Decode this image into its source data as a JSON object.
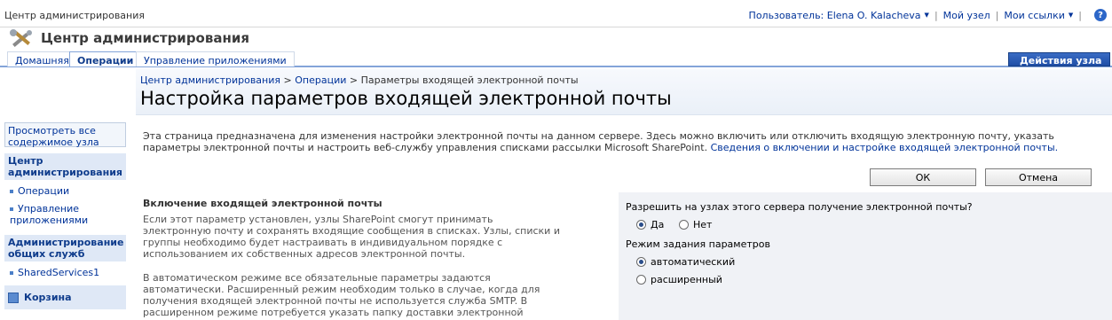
{
  "global": {
    "site_name": "Центр администрирования",
    "user_label": "Пользователь: Elena O. Kalacheva",
    "my_site": "Мой узел",
    "my_links": "Мои ссылки",
    "help": "?"
  },
  "title": {
    "site_title": "Центр администрирования"
  },
  "tabs": [
    {
      "label": "Домашняя",
      "selected": false
    },
    {
      "label": "Операции",
      "selected": true
    },
    {
      "label": "Управление приложениями",
      "selected": false
    }
  ],
  "site_actions": "Действия узла",
  "leftnav": {
    "view_all": "Просмотреть все содержимое узла",
    "heading1": "Центр администрирования",
    "items1": [
      "Операции",
      "Управление приложениями"
    ],
    "heading2": "Администрирование общих служб",
    "items2": [
      "SharedServices1"
    ],
    "recycle": "Корзина"
  },
  "breadcrumb": {
    "root": "Центр администрирования",
    "sep": ">",
    "ops": "Операции",
    "current": "Параметры входящей электронной почты"
  },
  "page_title": "Настройка параметров входящей электронной почты",
  "description": {
    "text": "Эта страница предназначена для изменения настройки электронной почты на данном сервере. Здесь можно включить или отключить входящую электронную почту, указать параметры электронной почты и настроить веб-службу управления списками рассылки Microsoft SharePoint.",
    "link": "Сведения о включении и настройке входящей электронной почты."
  },
  "buttons": {
    "ok": "ОК",
    "cancel": "Отмена"
  },
  "section": {
    "title": "Включение входящей электронной почты",
    "p1": "Если этот параметр установлен, узлы SharePoint смогут принимать электронную почту и сохранять входящие сообщения в списках. Узлы, списки и группы необходимо будет настраивать в индивидуальном порядке с использованием их собственных адресов электронной почты.",
    "p2": "В автоматическом режиме все обязательные параметры задаются автоматически. Расширенный режим необходим только в случае, когда для получения входящей электронной почты не используется служба SMTP. В расширенном режиме потребуется указать папку доставки электронной почты.",
    "allow_question": "Разрешить на узлах этого сервера получение электронной почты?",
    "allow_yes": "Да",
    "allow_no": "Нет",
    "allow_value": "Да",
    "mode_label": "Режим задания параметров",
    "mode_auto": "автоматический",
    "mode_advanced": "расширенный",
    "mode_value": "автоматический"
  }
}
